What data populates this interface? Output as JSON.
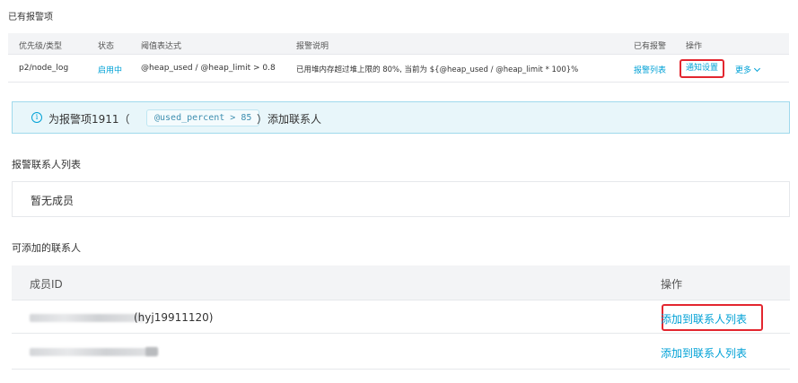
{
  "existing_alerts": {
    "title": "已有报警项",
    "columns": {
      "priority_type": "优先级/类型",
      "status": "状态",
      "threshold_expr": "阈值表达式",
      "alert_desc": "报警说明",
      "existing_alerts": "已有报警",
      "actions": "操作"
    },
    "row": {
      "priority_type": "p2/node_log",
      "status": "启用中",
      "threshold_expr": "@heap_used / @heap_limit > 0.8",
      "alert_desc": "已用堆内存超过堆上限的 80%, 当前为 ${@heap_used / @heap_limit * 100}%",
      "alert_list_link": "报警列表",
      "notify_settings_button": "通知设置",
      "more_menu": "更多"
    }
  },
  "info_bar": {
    "text_before": "为报警项1911（",
    "expression": "@used_percent > 85",
    "text_after": "）添加联系人"
  },
  "alert_contacts": {
    "title": "报警联系人列表",
    "empty_text": "暂无成员"
  },
  "available_contacts": {
    "title": "可添加的联系人",
    "columns": {
      "member_id": "成员ID",
      "actions": "操作"
    },
    "rows": [
      {
        "member_suffix": "(hyj19911120)",
        "add_label": "添加到联系人列表"
      },
      {
        "member_suffix": "",
        "add_label": "添加到联系人列表"
      }
    ]
  },
  "colors": {
    "link": "#00a1d6",
    "highlight_border": "#e3262f",
    "info_background": "#e8f6fa"
  },
  "icons": [
    "info-circle-icon",
    "chevron-down-icon"
  ]
}
